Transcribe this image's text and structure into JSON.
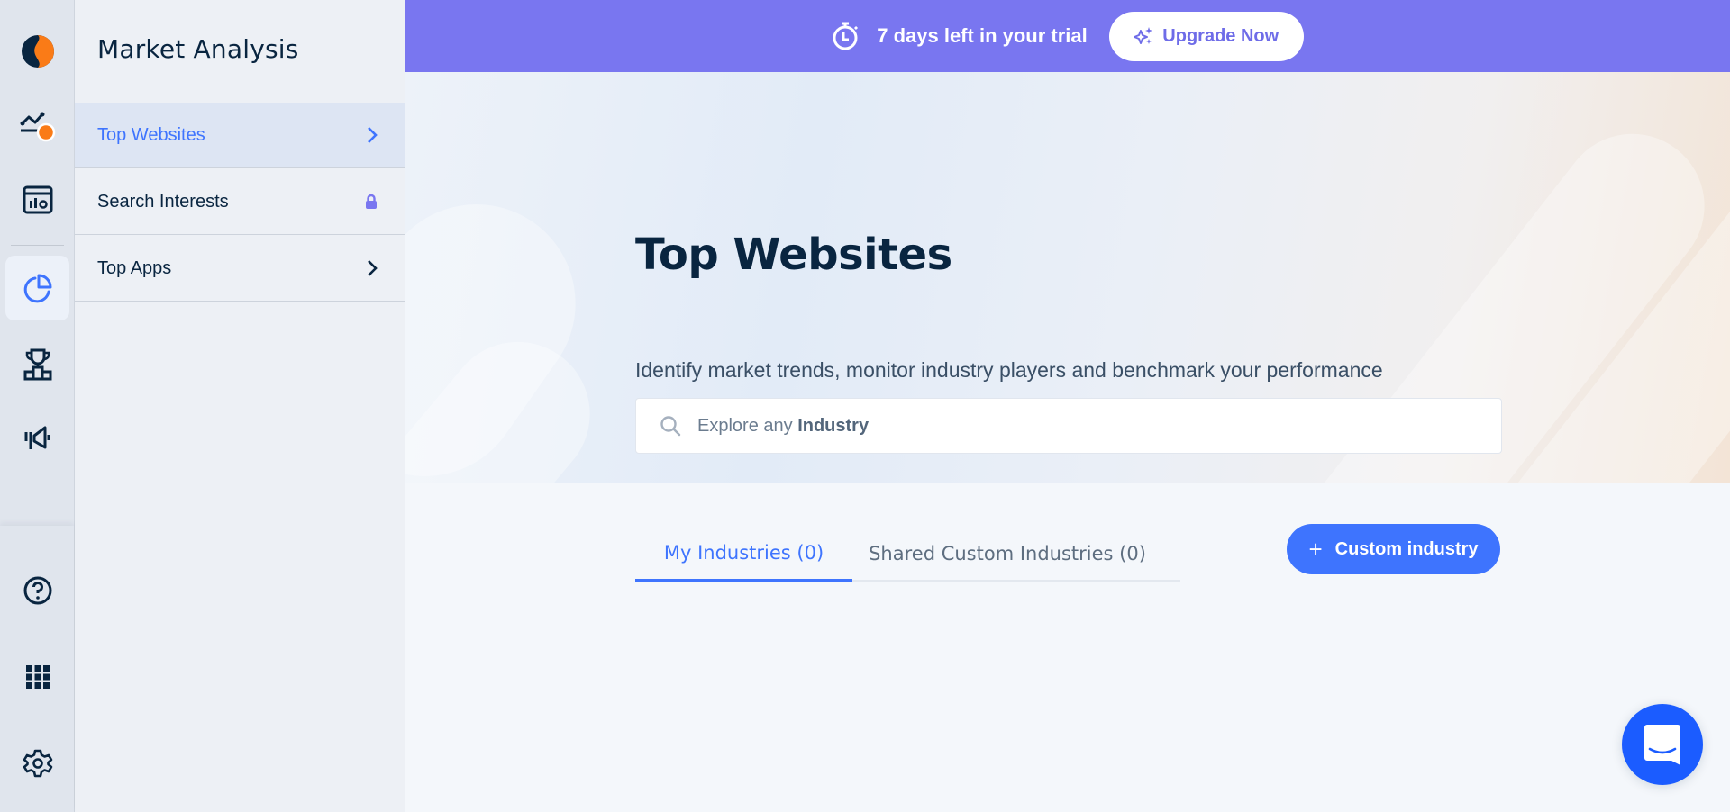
{
  "rail": {
    "items": [
      {
        "icon": "logo-icon"
      },
      {
        "icon": "trend-alert-icon"
      },
      {
        "icon": "chart-window-icon"
      },
      {
        "icon": "pie-chart-icon",
        "active": true
      },
      {
        "icon": "trophy-icon"
      },
      {
        "icon": "megaphone-icon"
      },
      {
        "icon": "funnel-icon"
      },
      {
        "icon": "help-icon"
      },
      {
        "icon": "apps-grid-icon"
      },
      {
        "icon": "gear-icon"
      }
    ]
  },
  "panel": {
    "title": "Market Analysis",
    "items": [
      {
        "label": "Top Websites",
        "trail": "chevron-right",
        "active": true
      },
      {
        "label": "Search Interests",
        "trail": "lock"
      },
      {
        "label": "Top Apps",
        "trail": "chevron-right"
      }
    ]
  },
  "banner": {
    "text": "7 days left in your trial",
    "upgrade_label": "Upgrade Now",
    "color": "#7976f0"
  },
  "hero": {
    "title": "Top Websites",
    "subtitle": "Identify market trends, monitor industry players and benchmark your performance",
    "search_placeholder_prefix": "Explore any",
    "search_placeholder_bold": "Industry"
  },
  "tabs": [
    {
      "label": "My Industries (0)",
      "active": true
    },
    {
      "label": "Shared Custom Industries (0)",
      "active": false
    }
  ],
  "custom_industry_button": {
    "plus": "+",
    "label": "Custom industry"
  },
  "colors": {
    "accent": "#3e74fe",
    "brand_dark": "#092540",
    "brand_orange": "#fa7b17",
    "chat": "#1b5cff"
  }
}
